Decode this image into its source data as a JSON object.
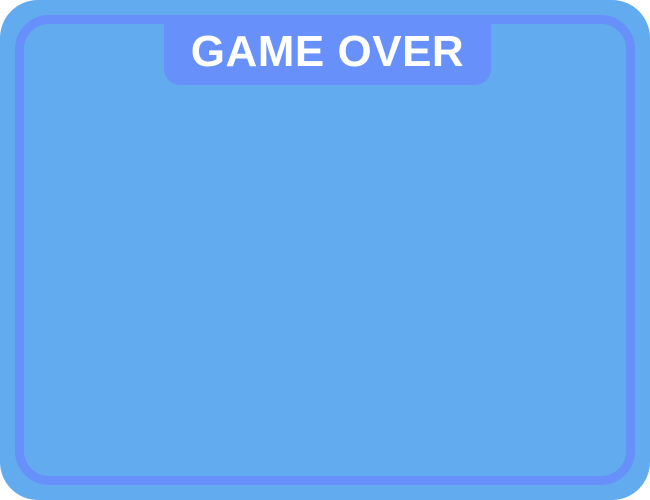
{
  "dialog": {
    "title": "GAME OVER"
  },
  "colors": {
    "panel_background": "#63abef",
    "frame_border": "#6790fb",
    "title_tab_background": "#6790fb",
    "title_text": "#ffffff"
  }
}
